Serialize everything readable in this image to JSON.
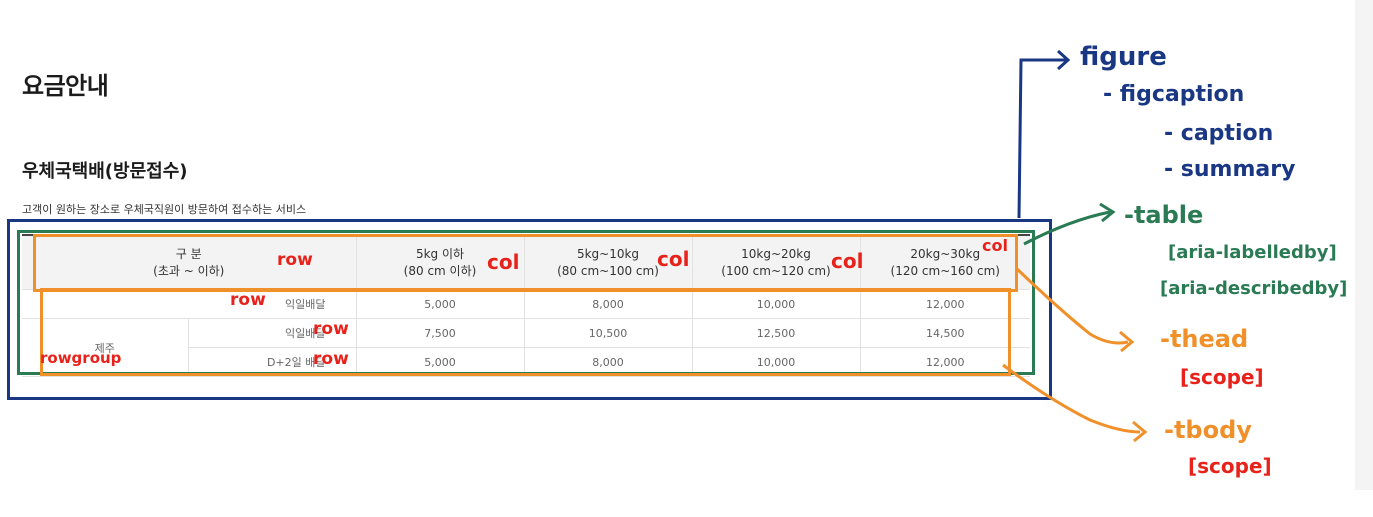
{
  "page": {
    "title": "요금안내",
    "section_title": "우체국택배(방문접수)",
    "section_desc": "고객이 원하는 장소로 우체국직원이 방문하여 접수하는 서비스"
  },
  "table": {
    "header": {
      "category": [
        "구 분",
        "(초과 ~ 이하)"
      ],
      "columns": [
        [
          "5kg 이하",
          "(80 cm 이하)"
        ],
        [
          "5kg~10kg",
          "(80 cm~100 cm)"
        ],
        [
          "10kg~20kg",
          "(100 cm~120 cm)"
        ],
        [
          "20kg~30kg",
          "(120 cm~160 cm)"
        ]
      ]
    },
    "rows": [
      {
        "label": "익일배달",
        "values": [
          "5,000",
          "8,000",
          "10,000",
          "12,000"
        ]
      },
      {
        "group": "제주",
        "label": "익일배달",
        "values": [
          "7,500",
          "10,500",
          "12,500",
          "14,500"
        ]
      },
      {
        "group": "제주",
        "label": "D+2일 배달",
        "values": [
          "5,000",
          "8,000",
          "10,000",
          "12,000"
        ]
      }
    ]
  },
  "annotations": {
    "row": "row",
    "col": "col",
    "col_small": "col",
    "rowgroup": "rowgroup",
    "figure": "figure",
    "figcaption": "- figcaption",
    "caption": "- caption",
    "summary": "- summary",
    "table": "-table",
    "aria_labelledby": "[aria-labelledby]",
    "aria_describedby": "[aria-describedby]",
    "thead": "-thead",
    "thead_scope": "[scope]",
    "tbody": "-tbody",
    "tbody_scope": "[scope]"
  },
  "colors": {
    "figure": "#1a3784",
    "table": "#2a7a54",
    "thead_tbody": "#f0902b",
    "tag": "#e8221a"
  }
}
